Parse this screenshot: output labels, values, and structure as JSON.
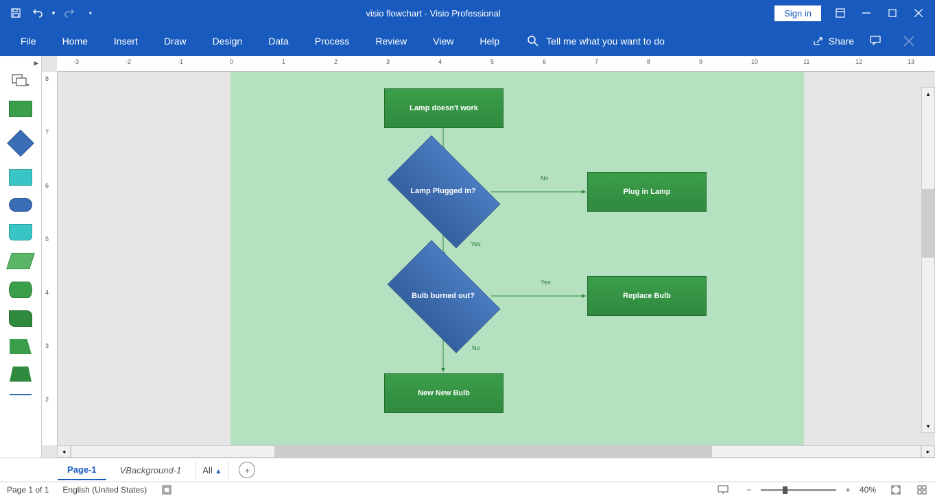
{
  "title": {
    "doc": "visio flowchart",
    "sep": "  -  ",
    "app": "Visio Professional"
  },
  "window": {
    "signin": "Sign in"
  },
  "ribbon": {
    "tabs": [
      "File",
      "Home",
      "Insert",
      "Draw",
      "Design",
      "Data",
      "Process",
      "Review",
      "View",
      "Help"
    ],
    "tellme": "Tell me what you want to do",
    "share": "Share"
  },
  "pagetabs": {
    "active": "Page-1",
    "bg": "VBackground-1",
    "all": "All"
  },
  "status": {
    "pages": "Page 1 of 1",
    "lang": "English (United States)",
    "zoom": "40%"
  },
  "hruler": [
    "-3",
    "-2",
    "-1",
    "0",
    "1",
    "2",
    "3",
    "4",
    "5",
    "6",
    "7",
    "8",
    "9",
    "10",
    "11",
    "12",
    "13"
  ],
  "vruler": [
    "8",
    "7",
    "6",
    "5",
    "4",
    "3",
    "2"
  ],
  "flow": {
    "n1": "Lamp doesn't work",
    "n2": "Lamp Plugged in?",
    "n3": "Plug in Lamp",
    "n4": "Bulb burned out?",
    "n5": "Replace Bulb",
    "n6": "New New Bulb",
    "e_no1": "No",
    "e_yes1": "Yes",
    "e_yes2": "Yes",
    "e_no2": "No"
  }
}
